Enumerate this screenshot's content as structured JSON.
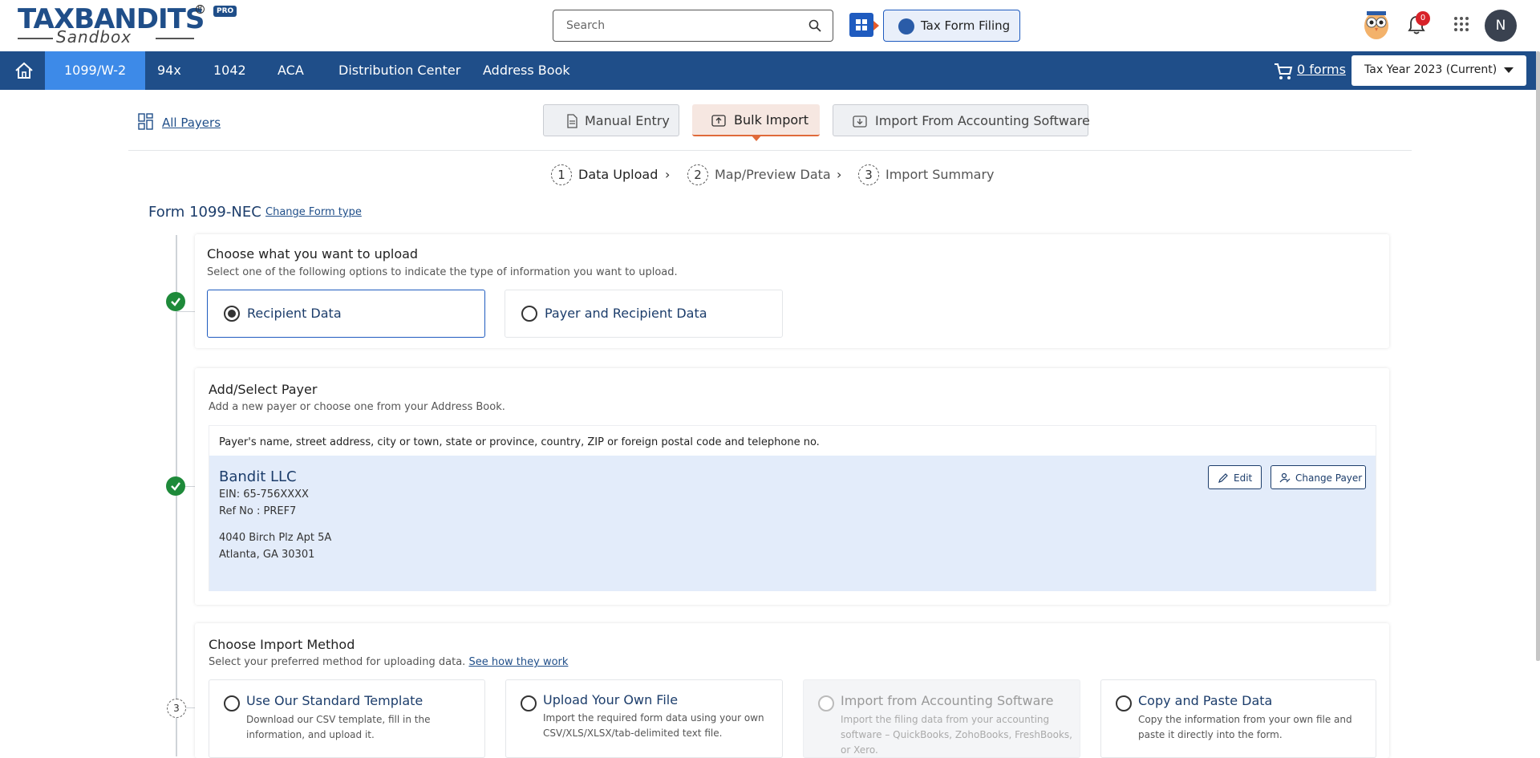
{
  "header": {
    "logo_text": "TAXBANDITS",
    "logo_sub": "Sandbox",
    "logo_badge": "PRO",
    "search_placeholder": "Search",
    "tax_form_filing": "Tax Form Filing",
    "notification_count": "0",
    "avatar_initial": "N"
  },
  "nav": {
    "items": [
      "1099/W-2",
      "94x",
      "1042",
      "ACA",
      "Distribution Center",
      "Address Book"
    ],
    "active": "1099/W-2",
    "cart_label": "0 forms",
    "tax_year": "Tax Year 2023 (Current)"
  },
  "subbar": {
    "all_payers": "All Payers",
    "tabs": [
      "Manual Entry",
      "Bulk Import",
      "Import From Accounting Software"
    ],
    "active_tab": "Bulk Import"
  },
  "steps": [
    {
      "num": "1",
      "label": "Data Upload"
    },
    {
      "num": "2",
      "label": "Map/Preview Data"
    },
    {
      "num": "3",
      "label": "Import Summary"
    }
  ],
  "form": {
    "title": "Form 1099-NEC",
    "change_type": "Change Form type"
  },
  "upload": {
    "title": "Choose what you want to upload",
    "desc": "Select one of the following options to indicate the type of information you want to upload.",
    "options": [
      "Recipient Data",
      "Payer and Recipient Data"
    ],
    "selected": "Recipient Data"
  },
  "payer": {
    "title": "Add/Select Payer",
    "desc": "Add a new payer or choose one from your Address Book.",
    "header": "Payer's name, street address, city or town, state or province, country, ZIP or foreign postal code and telephone no.",
    "name": "Bandit LLC",
    "ein": "EIN: 65-756XXXX",
    "ref": "Ref No : PREF7",
    "address1": "4040 Birch Plz Apt 5A",
    "address2": "Atlanta, GA 30301",
    "edit": "Edit",
    "change": "Change Payer"
  },
  "import": {
    "step_num": "3",
    "title": "Choose Import Method",
    "desc": "Select your preferred method for uploading data.",
    "see_how": "See how they work",
    "methods": [
      {
        "title": "Use Our Standard Template",
        "desc": "Download our CSV template, fill in the information, and upload it."
      },
      {
        "title": "Upload Your Own File",
        "desc": "Import the required form data using your own CSV/XLS/XLSX/tab-delimited text file."
      },
      {
        "title": "Import from Accounting Software",
        "desc": "Import the filing data from your accounting software – QuickBooks, ZohoBooks, FreshBooks, or Xero."
      },
      {
        "title": "Copy and Paste Data",
        "desc": "Copy the information from your own file and paste it directly into the form."
      }
    ]
  },
  "colors": {
    "brand_navy": "#1f4e89",
    "nav_active": "#3d8ae8",
    "accent_orange": "#e06a3a",
    "check_green": "#1e8a3a",
    "payer_bg": "#e3ecfa"
  }
}
